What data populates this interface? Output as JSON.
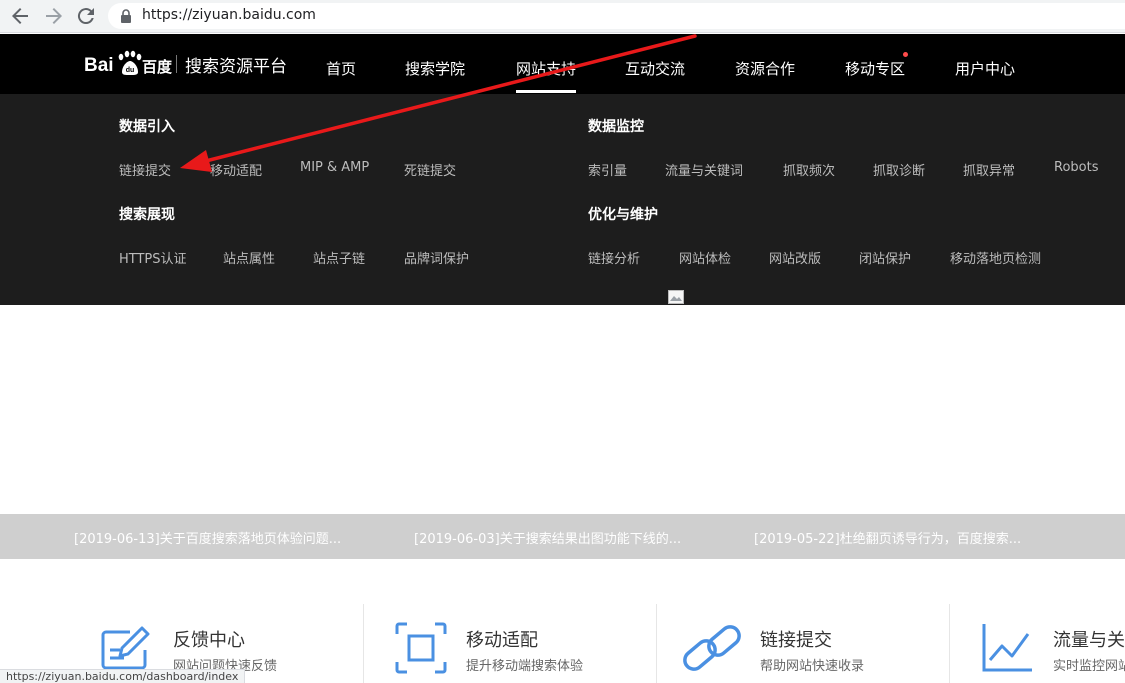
{
  "browser": {
    "url": "https://ziyuan.baidu.com",
    "status_url": "https://ziyuan.baidu.com/dashboard/index"
  },
  "header": {
    "logo_text": "Bai百度",
    "platform_title": "搜索资源平台",
    "nav": [
      "首页",
      "搜索学院",
      "网站支持",
      "互动交流",
      "资源合作",
      "移动专区",
      "用户中心"
    ],
    "active_nav": "网站支持"
  },
  "dropdown": {
    "left": [
      {
        "heading": "数据引入",
        "links": [
          "链接提交",
          "移动适配",
          "MIP & AMP",
          "死链提交"
        ]
      },
      {
        "heading": "搜索展现",
        "links": [
          "HTTPS认证",
          "站点属性",
          "站点子链",
          "品牌词保护"
        ]
      }
    ],
    "right": [
      {
        "heading": "数据监控",
        "links": [
          "索引量",
          "流量与关键词",
          "抓取频次",
          "抓取诊断",
          "抓取异常",
          "Robots"
        ]
      },
      {
        "heading": "优化与维护",
        "links": [
          "链接分析",
          "网站体检",
          "网站改版",
          "闭站保护",
          "移动落地页检测"
        ]
      }
    ]
  },
  "ticker": [
    "[2019-06-13]关于百度搜索落地页体验问题...",
    "[2019-06-03]关于搜索结果出图功能下线的...",
    "[2019-05-22]杜绝翻页诱导行为，百度搜索..."
  ],
  "cards": [
    {
      "title": "反馈中心",
      "subtitle": "网站问题快速反馈",
      "icon": "feedback-icon"
    },
    {
      "title": "移动适配",
      "subtitle": "提升移动端搜索体验",
      "icon": "mobile-adapt-icon"
    },
    {
      "title": "链接提交",
      "subtitle": "帮助网站快速收录",
      "icon": "link-icon"
    },
    {
      "title": "流量与关",
      "subtitle": "实时监控网站",
      "icon": "chart-icon"
    }
  ],
  "colors": {
    "nav_bg": "#000000",
    "dropdown_bg": "#1d1d1d",
    "accent_blue": "#4a90e2",
    "annotation_red": "#e8191a"
  }
}
